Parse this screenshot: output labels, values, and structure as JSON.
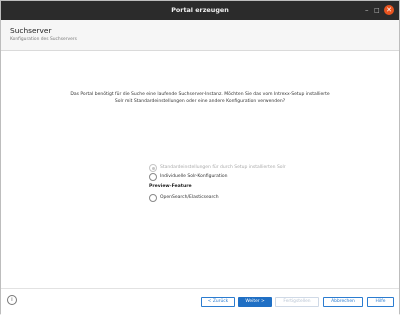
{
  "window": {
    "title": "Portal erzeugen",
    "min_glyph": "–",
    "max_glyph": "□",
    "close_glyph": "✕"
  },
  "header": {
    "title": "Suchserver",
    "subtitle": "Konfiguration des Suchservers"
  },
  "question": {
    "line1": "Das Portal benötigt für die Suche eine laufende Suchserver-Instanz. Möchten Sie das vom Intrexx-Setup installierte",
    "line2": "Solr mit Standardeinstellungen oder eine andere Konfiguration verwenden?"
  },
  "options": [
    {
      "label": "Standardeinstellungen für durch Setup installierten Solr",
      "checked": true,
      "disabled": true
    },
    {
      "label": "Individuelle Solr-Konfiguration",
      "checked": false,
      "disabled": false
    }
  ],
  "preview": {
    "label": "Preview-Feature",
    "option": {
      "label": "OpenSearch/Elasticsearch",
      "checked": false
    }
  },
  "footer": {
    "info_glyph": "i",
    "back": "< Zurück",
    "next": "Weiter >",
    "finish": "Fertigstellen",
    "cancel": "Abbrechen",
    "help": "Hilfe"
  },
  "colors": {
    "accent": "#1f6fc4",
    "titlebar": "#2b2b2b",
    "close": "#e9541f"
  }
}
